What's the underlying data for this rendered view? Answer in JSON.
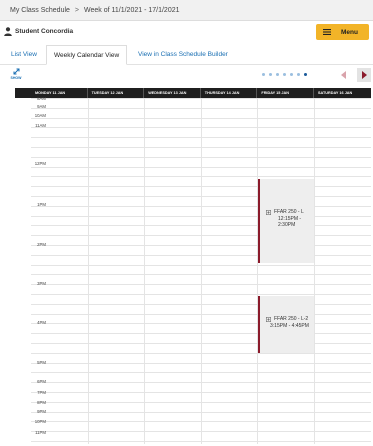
{
  "breadcrumb": {
    "root": "My Class Schedule",
    "separator": ">",
    "current": "Week of 11/1/2021 - 17/1/2021"
  },
  "user": {
    "name": "Student Concordia"
  },
  "menu_button": {
    "label": "Menu",
    "color": "#f2b428"
  },
  "tabs": [
    {
      "label": "List View",
      "active": false
    },
    {
      "label": "Weekly Calendar View",
      "active": true
    },
    {
      "label": "View in Class Schedule Builder",
      "active": false
    }
  ],
  "show_toggle": {
    "label": "SHOW"
  },
  "pager": {
    "count": 7,
    "active_index": 6
  },
  "calendar": {
    "days": [
      "MONDAY 11 JAN",
      "TUESDAY 12 JAN",
      "WEDNESDAY 13 JAN",
      "THURSDAY 14 JAN",
      "FRIDAY 15 JAN",
      "SATURDAY 16 JAN"
    ],
    "time_labels": [
      "8AM",
      "9AM",
      "10AM",
      "11AM",
      "12PM",
      "1PM",
      "2PM",
      "3PM",
      "4PM",
      "5PM",
      "6PM",
      "7PM",
      "8PM",
      "9PM",
      "10PM",
      "11PM"
    ],
    "events": [
      {
        "title": "FFAR 250 - L",
        "time_line1": "12:15PM -",
        "time_line2": "2:30PM",
        "day": "FRIDAY 15 JAN"
      },
      {
        "title": "FFAR 250 - L-2",
        "time_line1": "3:15PM - 4:45PM",
        "time_line2": "",
        "day": "FRIDAY 15 JAN"
      }
    ],
    "event_accent": "#8b1a2b"
  }
}
